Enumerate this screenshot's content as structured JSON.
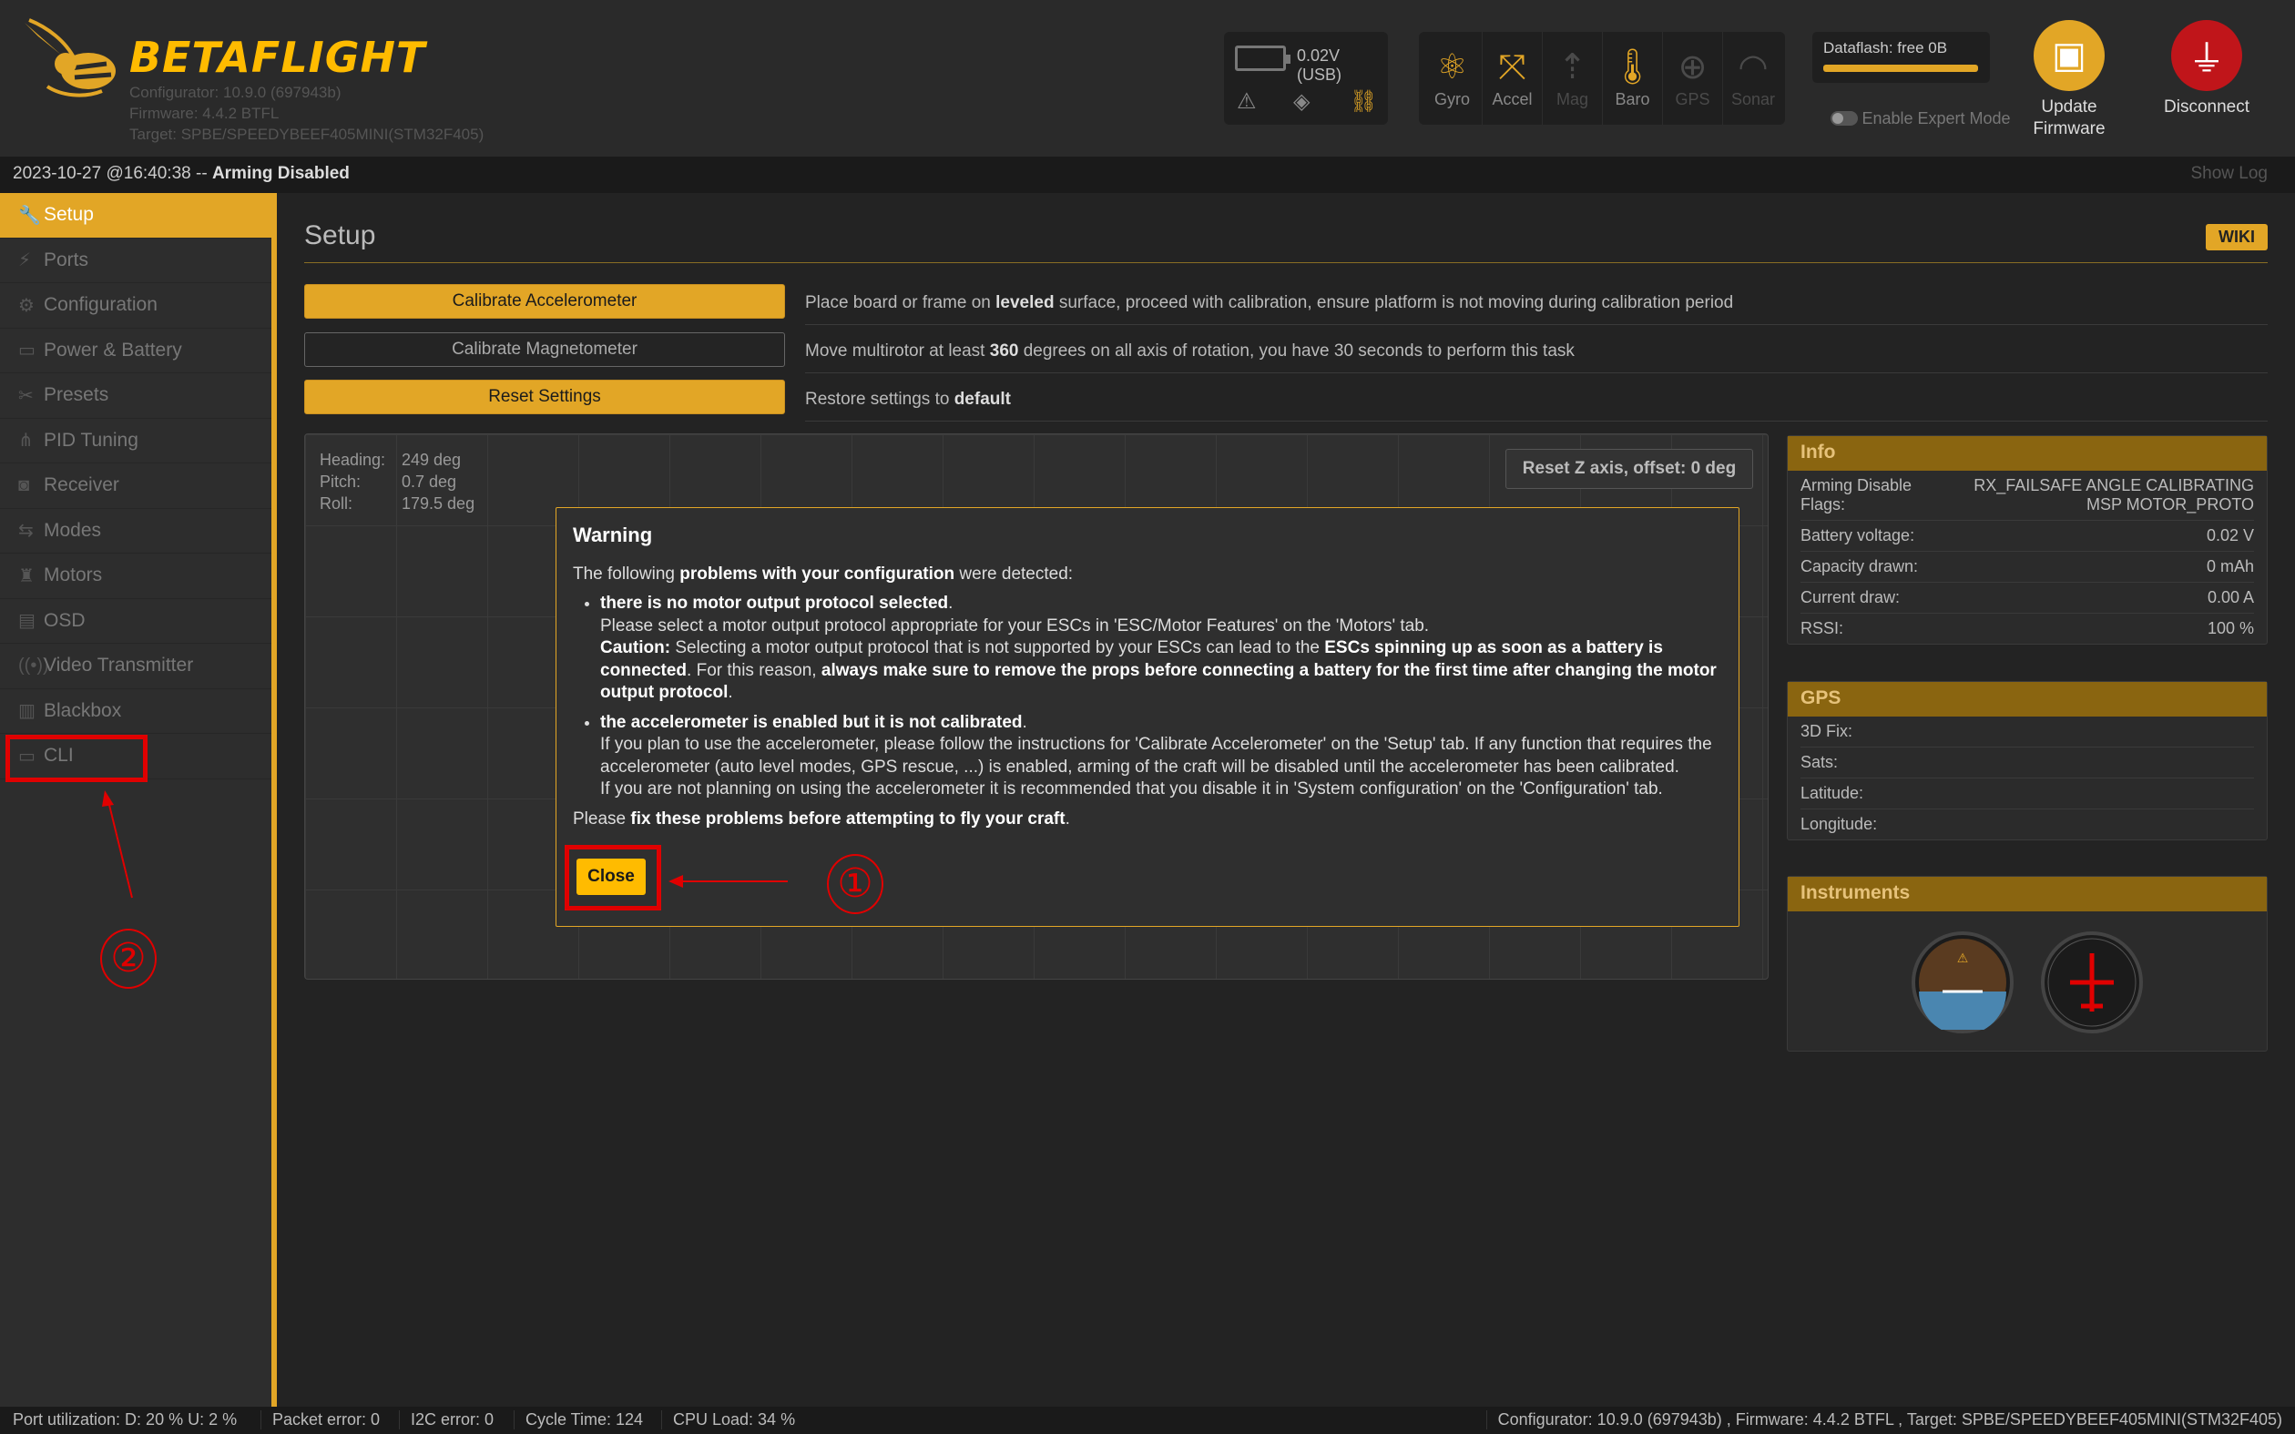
{
  "header": {
    "logo_text_a": "BETA",
    "logo_text_b": "FLIGHT",
    "configurator": "Configurator: 10.9.0 (697943b)",
    "firmware": "Firmware: 4.4.2 BTFL",
    "target": "Target: SPBE/SPEEDYBEEF405MINI(STM32F405)",
    "battery_voltage": "0.02V (USB)",
    "sensors": [
      {
        "label": "Gyro",
        "icon": "gyro-icon",
        "active": true
      },
      {
        "label": "Accel",
        "icon": "accel-icon",
        "active": true
      },
      {
        "label": "Mag",
        "icon": "mag-icon",
        "active": false
      },
      {
        "label": "Baro",
        "icon": "baro-icon",
        "active": true
      },
      {
        "label": "GPS",
        "icon": "gps-icon",
        "active": false
      },
      {
        "label": "Sonar",
        "icon": "sonar-icon",
        "active": false
      }
    ],
    "dataflash": "Dataflash: free 0B",
    "expert_mode": "Enable Expert Mode",
    "update_firmware": "Update Firmware",
    "disconnect": "Disconnect"
  },
  "status": {
    "timestamp": "2023-10-27 @16:40:38 --",
    "arming": "Arming Disabled",
    "show_log": "Show Log"
  },
  "sidebar": {
    "items": [
      {
        "label": "Setup",
        "icon": "wrench-icon",
        "active": true
      },
      {
        "label": "Ports",
        "icon": "plug-icon"
      },
      {
        "label": "Configuration",
        "icon": "gear-icon"
      },
      {
        "label": "Power & Battery",
        "icon": "battery-icon"
      },
      {
        "label": "Presets",
        "icon": "presets-icon"
      },
      {
        "label": "PID Tuning",
        "icon": "pid-icon"
      },
      {
        "label": "Receiver",
        "icon": "receiver-icon"
      },
      {
        "label": "Modes",
        "icon": "toggle-icon"
      },
      {
        "label": "Motors",
        "icon": "motor-icon"
      },
      {
        "label": "OSD",
        "icon": "osd-icon"
      },
      {
        "label": "Video Transmitter",
        "icon": "vtx-icon"
      },
      {
        "label": "Blackbox",
        "icon": "blackbox-icon"
      },
      {
        "label": "CLI",
        "icon": "terminal-icon"
      }
    ]
  },
  "main": {
    "title": "Setup",
    "wiki": "WIKI",
    "calibrate_accel": "Calibrate Accelerometer",
    "calibrate_accel_desc_a": "Place board or frame on ",
    "calibrate_accel_desc_b": "leveled",
    "calibrate_accel_desc_c": " surface, proceed with calibration, ensure platform is not moving during calibration period",
    "calibrate_mag": "Calibrate Magnetometer",
    "calibrate_mag_desc_a": "Move multirotor at least ",
    "calibrate_mag_desc_b": "360",
    "calibrate_mag_desc_c": " degrees on all axis of rotation, you have 30 seconds to perform this task",
    "reset_settings": "Reset Settings",
    "reset_desc_a": "Restore settings to ",
    "reset_desc_b": "default",
    "heading_k": "Heading:",
    "heading_v": "249 deg",
    "pitch_k": "Pitch:",
    "pitch_v": "0.7 deg",
    "roll_k": "Roll:",
    "roll_v": "179.5 deg",
    "reset_z": "Reset Z axis, offset: 0 deg"
  },
  "info": {
    "title": "Info",
    "rows": [
      {
        "k": "Arming Disable Flags:",
        "v": "RX_FAILSAFE ANGLE CALIBRATING MSP MOTOR_PROTO"
      },
      {
        "k": "Battery voltage:",
        "v": "0.02 V"
      },
      {
        "k": "Capacity drawn:",
        "v": "0 mAh"
      },
      {
        "k": "Current draw:",
        "v": "0.00 A"
      },
      {
        "k": "RSSI:",
        "v": "100 %"
      }
    ]
  },
  "gps": {
    "title": "GPS",
    "rows": [
      {
        "k": "3D Fix:",
        "v": ""
      },
      {
        "k": "Sats:",
        "v": ""
      },
      {
        "k": "Latitude:",
        "v": ""
      },
      {
        "k": "Longitude:",
        "v": ""
      }
    ]
  },
  "instruments": {
    "title": "Instruments"
  },
  "modal": {
    "title": "Warning",
    "intro_a": "The following ",
    "intro_b": "problems with your configuration",
    "intro_c": " were detected:",
    "p1_title": "there is no motor output protocol selected",
    "p1_line1": "Please select a motor output protocol appropriate for your ESCs in 'ESC/Motor Features' on the 'Motors' tab.",
    "p1_caution": "Caution:",
    "p1_line2a": " Selecting a motor output protocol that is not supported by your ESCs can lead to the ",
    "p1_line2b": "ESCs spinning up as soon as a battery is connected",
    "p1_line2c": ". For this reason, ",
    "p1_line2d": "always make sure to remove the props before connecting a battery for the first time after changing the motor output protocol",
    "p2_title": "the accelerometer is enabled but it is not calibrated",
    "p2_line1": "If you plan to use the accelerometer, please follow the instructions for 'Calibrate Accelerometer' on the 'Setup' tab. If any function that requires the accelerometer (auto level modes, GPS rescue, ...) is enabled, arming of the craft will be disabled until the accelerometer has been calibrated.",
    "p2_line2": "If you are not planning on using the accelerometer it is recommended that you disable it in 'System configuration' on the 'Configuration' tab.",
    "outro_a": "Please ",
    "outro_b": "fix these problems before attempting to fly your craft",
    "outro_c": ".",
    "close": "Close"
  },
  "bottom": {
    "port_util": "Port utilization: D: 20 % U: 2 %",
    "packet_error": "Packet error: 0",
    "i2c_error": "I2C error: 0",
    "cycle_time": "Cycle Time: 124",
    "cpu_load": "CPU Load: 34 %",
    "right": "Configurator: 10.9.0 (697943b) , Firmware: 4.4.2 BTFL , Target: SPBE/SPEEDYBEEF405MINI(STM32F405)"
  },
  "annotations": {
    "one": "①",
    "two": "②"
  },
  "colors": {
    "accent": "#e2a626",
    "close_button": "#ffbb00",
    "annotation": "#e00000"
  }
}
